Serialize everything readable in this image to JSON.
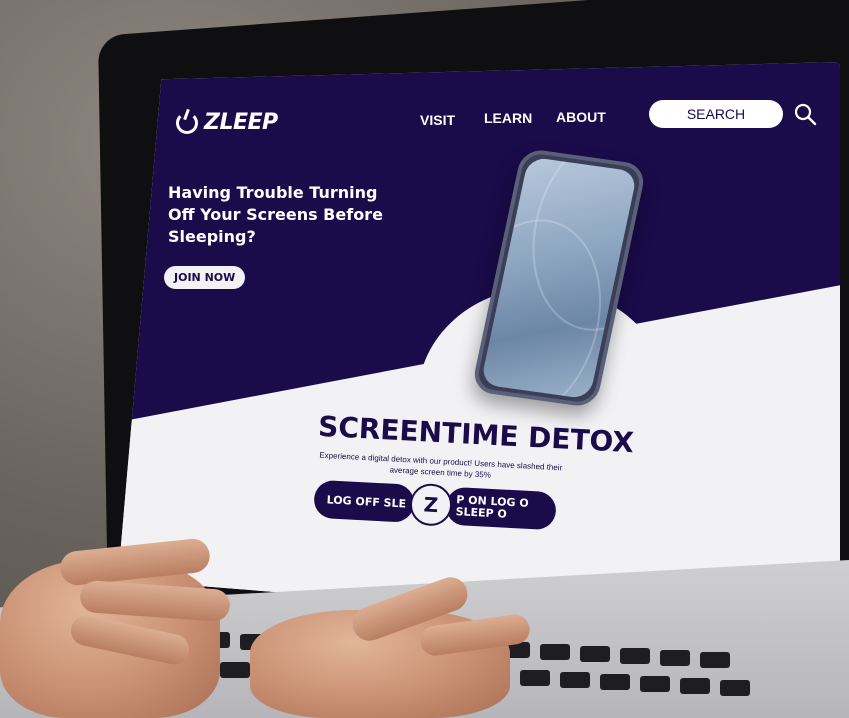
{
  "site": {
    "logo": "ZLEEP",
    "nav": [
      "VISIT",
      "LEARN",
      "ABOUT"
    ],
    "search_label": "SEARCH",
    "headline_lines": [
      "Having Trouble Turning",
      "Off Your Screens Before",
      "Sleeping?"
    ],
    "join_button": "JOIN NOW",
    "section_title": "SCREENTIME DETOX",
    "section_desc": "Experience a digital detox with our product! Users have slashed their average screen time by 35%",
    "marquee_left": "LOG OFF SLE",
    "marquee_badge": "Z",
    "marquee_right": "P ON LOG O",
    "marquee_right_2": "SLEEP O"
  },
  "colors": {
    "brand": "#1a0b4a",
    "screen_bg": "#f2f2f4",
    "text_light": "#ffffff"
  },
  "icons": {
    "search": "search-icon",
    "logo": "power-icon"
  }
}
